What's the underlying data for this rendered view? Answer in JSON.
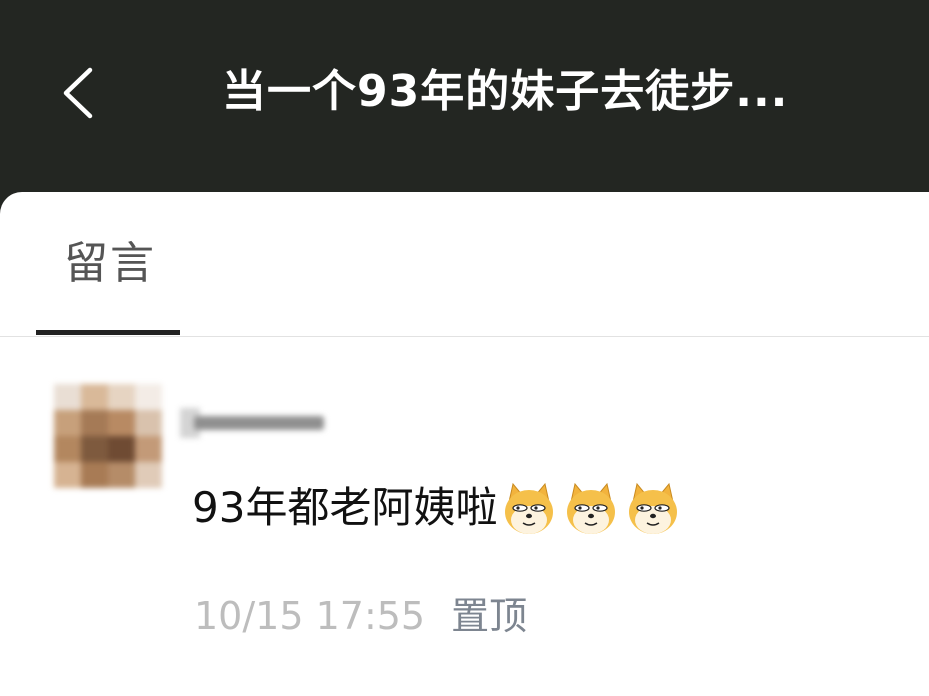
{
  "header": {
    "title": "当一个93年的妹子去徒步..."
  },
  "tabs": [
    {
      "label": "留言"
    }
  ],
  "comments": [
    {
      "text": "93年都老阿姨啦",
      "emojis": [
        "doge-emoji",
        "doge-emoji",
        "doge-emoji"
      ],
      "timestamp": "10/15 17:55",
      "pin_label": "置顶"
    }
  ],
  "colors": {
    "header_bg": "#232622",
    "sheet_bg": "#ffffff",
    "tab_underline": "#222222",
    "timestamp": "#bdbdbd",
    "action_link": "#7d8590"
  },
  "icons": {
    "back": "chevron-left-icon",
    "emoji": "doge-emoji-icon"
  }
}
